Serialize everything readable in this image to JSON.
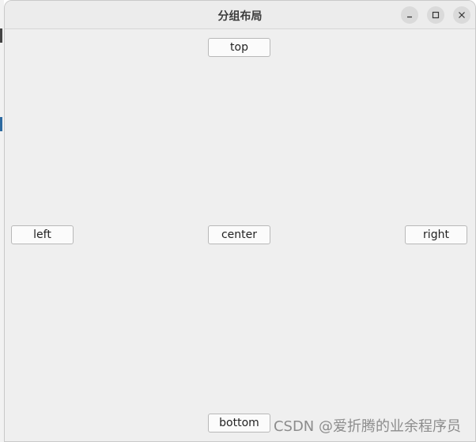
{
  "window": {
    "title": "分组布局"
  },
  "buttons": {
    "top": "top",
    "left": "left",
    "center": "center",
    "right": "right",
    "bottom": "bottom"
  },
  "watermark": "CSDN @爱折腾的业余程序员",
  "icons": {
    "minimize": "minimize-icon",
    "maximize": "maximize-icon",
    "close": "close-icon"
  }
}
